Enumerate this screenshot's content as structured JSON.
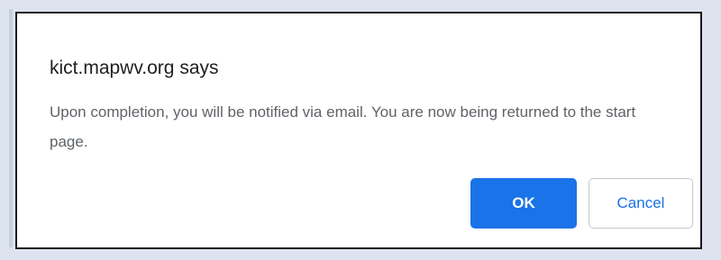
{
  "dialog": {
    "title": "kict.mapwv.org says",
    "message": "Upon completion, you will be notified via email. You are now being returned to the start page.",
    "ok_label": "OK",
    "cancel_label": "Cancel"
  },
  "colors": {
    "primary": "#1a73e8",
    "background": "#dde4ef",
    "text": "#202124",
    "message_text": "#5f6368"
  }
}
